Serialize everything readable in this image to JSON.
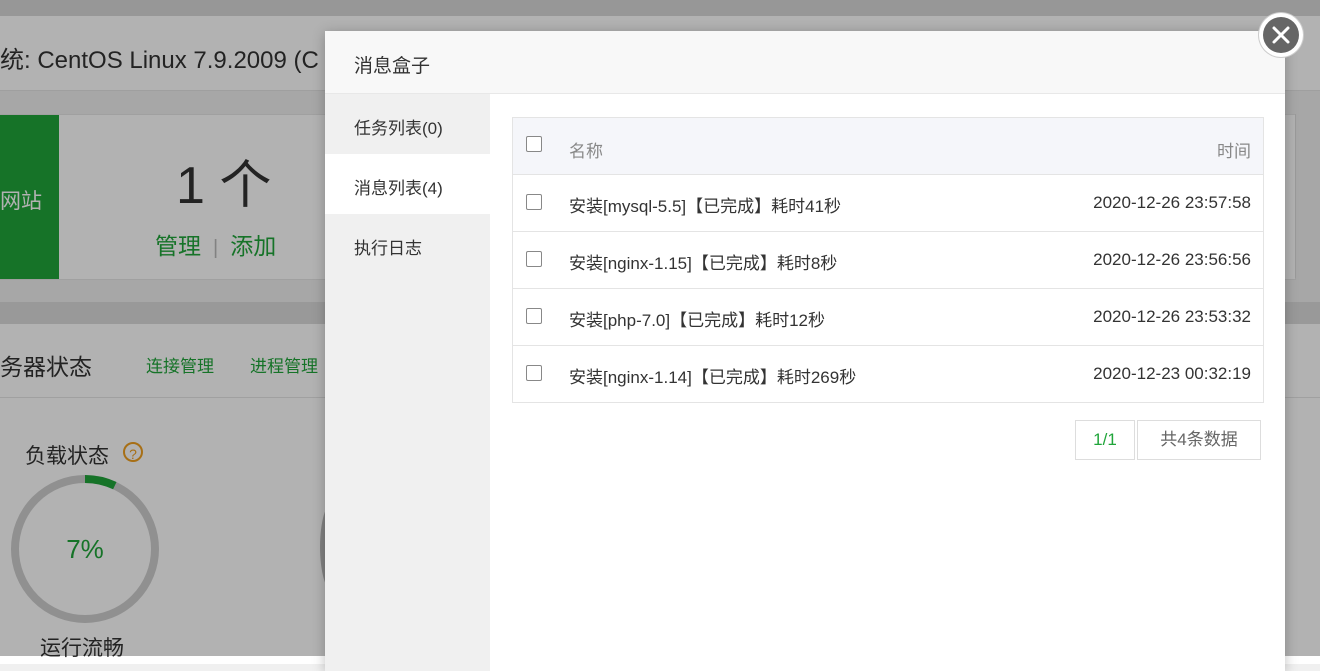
{
  "background": {
    "system_info": "统: CentOS Linux 7.9.2009 (C",
    "site_tab": "网站",
    "site_count": "1 个",
    "manage_link": "管理",
    "add_link": "添加",
    "server_status_title": "务器状态",
    "conn_manage": "连接管理",
    "proc_manage": "进程管理",
    "load_title": "负载状态",
    "load_percent": "7%",
    "load_value": 0.07,
    "load_state": "运行流畅"
  },
  "modal": {
    "title": "消息盒子",
    "tabs": [
      {
        "label": "任务列表(0)"
      },
      {
        "label": "消息列表(4)"
      },
      {
        "label": "执行日志"
      }
    ],
    "active_tab": 1,
    "table": {
      "headers": {
        "name": "名称",
        "time": "时间"
      },
      "rows": [
        {
          "name": "安装[mysql-5.5]【已完成】耗时41秒",
          "time": "2020-12-26 23:57:58"
        },
        {
          "name": "安装[nginx-1.15]【已完成】耗时8秒",
          "time": "2020-12-26 23:56:56"
        },
        {
          "name": "安装[php-7.0]【已完成】耗时12秒",
          "time": "2020-12-26 23:53:32"
        },
        {
          "name": "安装[nginx-1.14]【已完成】耗时269秒",
          "time": "2020-12-23 00:32:19"
        }
      ]
    },
    "pagination": {
      "page": "1/1",
      "total": "共4条数据"
    }
  },
  "colors": {
    "accent": "#20a53a",
    "warning": "#f0a020"
  },
  "icons": {
    "close": "close-icon",
    "help": "question-icon"
  }
}
